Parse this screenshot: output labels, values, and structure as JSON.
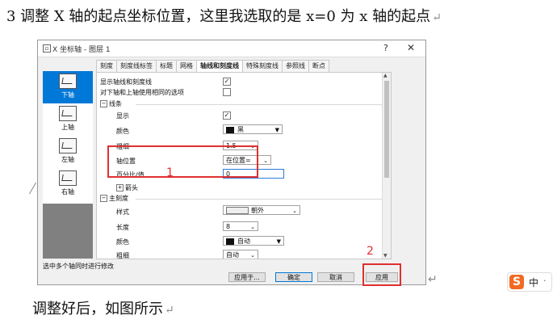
{
  "doc": {
    "line1": "3 调整 X 轴的起点坐标位置，这里我选取的是 x=0 为 x 轴的起点",
    "line2": "调整好后，如图所示",
    "return_mark": "↵"
  },
  "dialog": {
    "title": "X 坐标轴 - 图层 1",
    "help": "?",
    "close": "✕",
    "tabs": [
      "刻度",
      "刻度线标签",
      "标题",
      "网格",
      "轴线和刻度线",
      "特殊刻度线",
      "参照线",
      "断点"
    ],
    "active_tab": "轴线和刻度线",
    "side_items": [
      "下轴",
      "上轴",
      "左轴",
      "右轴"
    ],
    "selected_side": "下轴",
    "show_axis_label": "显示轴线和刻度线",
    "same_options_label": "对下轴和上轴使用相同的选项",
    "line_group": "线条",
    "show_label": "显示",
    "color_label": "颜色",
    "color_value": "黑",
    "thickness_label": "粗细",
    "thickness_value": "1.5",
    "axis_pos_label": "轴位置",
    "axis_pos_value": "在位置=",
    "percent_label": "百分比/值",
    "percent_value": "0",
    "arrow_label": "箭头",
    "major_group": "主刻度",
    "style_label": "样式",
    "style_value": "朝外",
    "length_label": "长度",
    "length_value": "8",
    "major_color_label": "颜色",
    "major_color_value": "自动",
    "major_thickness_label": "粗细",
    "major_thickness_value": "自动",
    "status": "选中多个轴同时进行修改",
    "buttons": {
      "apply_to": "应用于...",
      "ok": "确定",
      "cancel": "取消",
      "apply": "应用"
    }
  },
  "annotations": {
    "n1": "1",
    "n2": "2"
  },
  "ime": {
    "logo": "S",
    "mode": "中",
    "dot": "·"
  }
}
